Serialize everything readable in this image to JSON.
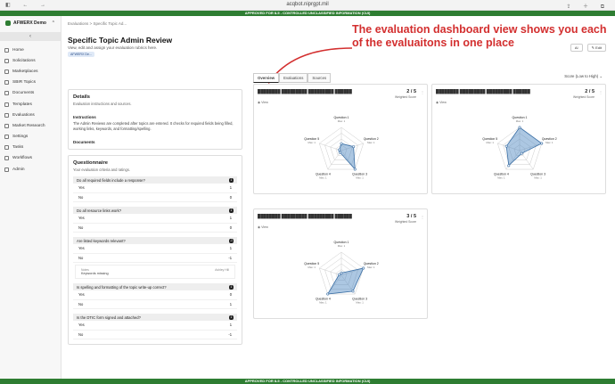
{
  "browser": {
    "url": "acqbot.niprgpt.mil"
  },
  "banner": {
    "top": "APPROVED FOR IL5 - CONTROLLED UNCLASSIFIED INFORMATION (CUI)",
    "bottom": "APPROVED FOR IL5 - CONTROLLED UNCLASSIFIED INFORMATION (CUI)"
  },
  "sidebar": {
    "org": "AFWERX Demo",
    "items": [
      {
        "label": "Home",
        "icon": "home-icon"
      },
      {
        "label": "Solicitations",
        "icon": "document-icon"
      },
      {
        "label": "Marketplaces",
        "icon": "store-icon"
      },
      {
        "label": "SBIR Topics",
        "icon": "list-icon"
      },
      {
        "label": "Documents",
        "icon": "file-icon"
      },
      {
        "label": "Templates",
        "icon": "template-icon"
      },
      {
        "label": "Evaluations",
        "icon": "clipboard-icon"
      },
      {
        "label": "Market Research",
        "icon": "search-icon"
      },
      {
        "label": "Settings",
        "icon": "gear-icon"
      },
      {
        "label": "Tasks",
        "icon": "check-icon"
      },
      {
        "label": "Workflows",
        "icon": "flow-icon"
      },
      {
        "label": "Admin",
        "icon": "shield-icon"
      }
    ]
  },
  "breadcrumb": {
    "parent": "Evaluations",
    "sep": ">",
    "current": "Specific Topic Ad..."
  },
  "page": {
    "title": "Specific Topic Admin Review",
    "subtitle": "View, edit and assign your evaluation rubrics here.",
    "org_badge": "AFWERX De...",
    "ai_label": "AI",
    "edit_label": "Edit"
  },
  "annotation": "The evaluation dashboard view shows you each of the evaluaitons in one place",
  "details": {
    "title": "Details",
    "subtitle": "Evaluation instructions and sources.",
    "instructions_title": "Instructions",
    "instructions_text": "The Admin Reviews are completed after topics are entered. It checks for required fields being filled, working links, keywords, and formatting/spelling.",
    "documents_title": "Documents"
  },
  "questionnaire": {
    "title": "Questionnaire",
    "subtitle": "Your evaluation criteria and ratings.",
    "questions": [
      {
        "text": "Do all required fields include a response?",
        "badge": "1",
        "options": [
          {
            "label": "Yes",
            "value": "1"
          },
          {
            "label": "No",
            "value": "0"
          }
        ]
      },
      {
        "text": "Do all resource links work?",
        "badge": "1",
        "options": [
          {
            "label": "Yes",
            "value": "1"
          },
          {
            "label": "No",
            "value": "0"
          }
        ]
      },
      {
        "text": "Are listed keywords relevant?",
        "badge": "-1",
        "options": [
          {
            "label": "Yes",
            "value": "1"
          },
          {
            "label": "No",
            "value": "-1"
          }
        ],
        "notes_label": "Notes",
        "notes_meta": "Ashley Hill",
        "notes_text": "Keywords missing"
      },
      {
        "text": "Is spelling and formatting of the topic write-up correct?",
        "badge": "1",
        "options": [
          {
            "label": "Yes",
            "value": "0"
          },
          {
            "label": "No",
            "value": "1"
          }
        ]
      },
      {
        "text": "Is the DTIC form signed and attached?",
        "badge": "1",
        "options": [
          {
            "label": "Yes",
            "value": "1"
          },
          {
            "label": "No",
            "value": "-1"
          }
        ]
      }
    ]
  },
  "tabs": [
    {
      "label": "Overview",
      "active": true
    },
    {
      "label": "Evaluations",
      "active": false
    },
    {
      "label": "Sources",
      "active": false
    }
  ],
  "sort": {
    "label": "Score (Low to High)"
  },
  "evaluations": [
    {
      "title": "████████ █████████ █████████ ██████",
      "view": "View",
      "score": "2 / 5",
      "weighted_label": "Weighted Score",
      "axes": [
        {
          "label": "Question 1",
          "sub": "Max: 1"
        },
        {
          "label": "Question 2",
          "sub": "Max: 1"
        },
        {
          "label": "Question 3",
          "sub": "Max: 1"
        },
        {
          "label": "Question 4",
          "sub": "Max: 1"
        },
        {
          "label": "Question 5",
          "sub": "Max: 1"
        }
      ],
      "values": [
        0.3,
        0.55,
        1.0,
        0.1,
        0.1
      ]
    },
    {
      "title": "████████ █████████ █████████ ██████",
      "view": "View",
      "score": "2 / 5",
      "weighted_label": "Weighted Score",
      "axes": [
        {
          "label": "Question 1",
          "sub": "Max: 1"
        },
        {
          "label": "Question 2",
          "sub": "Max: 1"
        },
        {
          "label": "Question 3",
          "sub": "Max: 1"
        },
        {
          "label": "Question 4",
          "sub": "Max: 1"
        },
        {
          "label": "Question 5",
          "sub": "Max: 1"
        }
      ],
      "values": [
        1.0,
        1.0,
        0.15,
        0.8,
        0.6
      ]
    },
    {
      "title": "████████ █████████ █████████ ██████",
      "view": "View",
      "score": "3 / 5",
      "weighted_label": "Weighted Score",
      "axes": [
        {
          "label": "Question 1",
          "sub": "Max: 1"
        },
        {
          "label": "Question 2",
          "sub": "Max: 1"
        },
        {
          "label": "Question 3",
          "sub": "Max: 1"
        },
        {
          "label": "Question 4",
          "sub": "Max: 1"
        },
        {
          "label": "Question 5",
          "sub": "Max: 1"
        }
      ],
      "values": [
        0.1,
        1.0,
        0.85,
        1.0,
        0.1
      ]
    }
  ]
}
